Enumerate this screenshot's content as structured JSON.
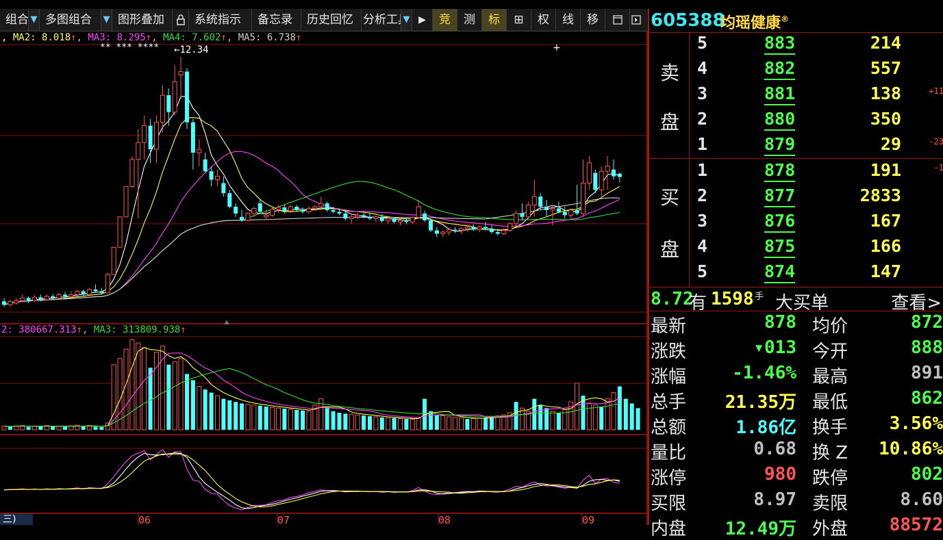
{
  "toolbar": {
    "items": [
      "组合",
      "多图组合",
      "图形叠加",
      "系统指示",
      "备忘录",
      "历史回忆",
      "分析工具"
    ],
    "lock_icon": "lock-icon",
    "play": "▶",
    "icons": [
      "竞",
      "测",
      "标",
      "⊞",
      "权",
      "线",
      "移"
    ],
    "more_icons": [
      "window-icon",
      "next-icon"
    ]
  },
  "legend_main": {
    "ma1": ",",
    "ma2": "MA2: 8.018",
    "ma3": "MA3: 8.295",
    "ma4": "MA4: 7.602",
    "ma5": "MA5: 6.738",
    "peak_label": "12.34",
    "stars": "**  ***  ****"
  },
  "legend_vol": {
    "ma2": "2: 380667.313",
    "ma3": "MA3: 313809.938"
  },
  "x_axis": {
    "left_tab": "三)",
    "months": [
      "06",
      "07",
      "08",
      "09"
    ]
  },
  "colors": {
    "up": "#ff5555",
    "down": "#4dffff",
    "ma1": "#ffffff",
    "ma2": "#ffff4d",
    "ma3": "#ff44ff",
    "ma4": "#33dd33",
    "ma5": "#d0d0d0",
    "grid": "#8a1010"
  },
  "chart_data": {
    "type": "candlestick",
    "candles": [
      {
        "o": 5.1,
        "h": 5.2,
        "l": 4.95,
        "c": 5.0
      },
      {
        "o": 5.0,
        "h": 5.15,
        "l": 4.95,
        "c": 5.1
      },
      {
        "o": 5.05,
        "h": 5.2,
        "l": 5.0,
        "c": 5.12
      },
      {
        "o": 5.12,
        "h": 5.3,
        "l": 5.08,
        "c": 5.2
      },
      {
        "o": 5.2,
        "h": 5.25,
        "l": 5.05,
        "c": 5.12
      },
      {
        "o": 5.12,
        "h": 5.28,
        "l": 5.08,
        "c": 5.22
      },
      {
        "o": 5.22,
        "h": 5.3,
        "l": 5.1,
        "c": 5.15
      },
      {
        "o": 5.15,
        "h": 5.3,
        "l": 5.12,
        "c": 5.25
      },
      {
        "o": 5.25,
        "h": 5.32,
        "l": 5.15,
        "c": 5.2
      },
      {
        "o": 5.2,
        "h": 5.35,
        "l": 5.15,
        "c": 5.3
      },
      {
        "o": 5.3,
        "h": 5.38,
        "l": 5.2,
        "c": 5.25
      },
      {
        "o": 5.25,
        "h": 5.4,
        "l": 5.2,
        "c": 5.3
      },
      {
        "o": 5.3,
        "h": 5.45,
        "l": 5.25,
        "c": 5.4
      },
      {
        "o": 5.4,
        "h": 5.45,
        "l": 5.25,
        "c": 5.3
      },
      {
        "o": 5.3,
        "h": 5.5,
        "l": 5.28,
        "c": 5.45
      },
      {
        "o": 5.45,
        "h": 5.6,
        "l": 5.35,
        "c": 5.4
      },
      {
        "o": 5.4,
        "h": 5.5,
        "l": 5.3,
        "c": 5.35
      },
      {
        "o": 5.35,
        "h": 5.95,
        "l": 5.35,
        "c": 5.9
      },
      {
        "o": 5.9,
        "h": 6.7,
        "l": 5.9,
        "c": 6.7
      },
      {
        "o": 6.7,
        "h": 7.6,
        "l": 6.7,
        "c": 7.6
      },
      {
        "o": 7.6,
        "h": 8.5,
        "l": 7.6,
        "c": 8.5
      },
      {
        "o": 8.5,
        "h": 9.4,
        "l": 8.45,
        "c": 9.3
      },
      {
        "o": 9.3,
        "h": 10.2,
        "l": 7.55,
        "c": 9.8
      },
      {
        "o": 9.8,
        "h": 10.6,
        "l": 9.3,
        "c": 10.3
      },
      {
        "o": 10.3,
        "h": 10.5,
        "l": 9.2,
        "c": 9.6
      },
      {
        "o": 9.6,
        "h": 10.6,
        "l": 9.2,
        "c": 10.4
      },
      {
        "o": 10.4,
        "h": 11.5,
        "l": 10.1,
        "c": 11.2
      },
      {
        "o": 11.2,
        "h": 11.4,
        "l": 10.3,
        "c": 10.7
      },
      {
        "o": 10.7,
        "h": 12.1,
        "l": 10.6,
        "c": 11.6
      },
      {
        "o": 11.8,
        "h": 12.34,
        "l": 11.1,
        "c": 11.9
      },
      {
        "o": 11.9,
        "h": 12.0,
        "l": 10.2,
        "c": 10.4
      },
      {
        "o": 10.4,
        "h": 10.5,
        "l": 9.0,
        "c": 9.5
      },
      {
        "o": 9.5,
        "h": 9.9,
        "l": 9.1,
        "c": 9.6
      },
      {
        "o": 9.3,
        "h": 9.5,
        "l": 8.9,
        "c": 8.95
      },
      {
        "o": 8.95,
        "h": 9.1,
        "l": 8.5,
        "c": 8.7
      },
      {
        "o": 8.7,
        "h": 9.0,
        "l": 8.5,
        "c": 8.8
      },
      {
        "o": 8.6,
        "h": 8.8,
        "l": 8.2,
        "c": 8.3
      },
      {
        "o": 8.3,
        "h": 8.4,
        "l": 7.85,
        "c": 7.9
      },
      {
        "o": 7.9,
        "h": 8.0,
        "l": 7.6,
        "c": 7.7
      },
      {
        "o": 7.6,
        "h": 7.8,
        "l": 7.45,
        "c": 7.5
      },
      {
        "o": 7.5,
        "h": 7.75,
        "l": 7.45,
        "c": 7.7
      },
      {
        "o": 7.7,
        "h": 7.9,
        "l": 7.6,
        "c": 7.85
      },
      {
        "o": 8.0,
        "h": 8.1,
        "l": 7.7,
        "c": 7.75
      },
      {
        "o": 7.6,
        "h": 7.8,
        "l": 7.5,
        "c": 7.65
      },
      {
        "o": 7.65,
        "h": 7.9,
        "l": 7.6,
        "c": 7.82
      },
      {
        "o": 7.82,
        "h": 7.95,
        "l": 7.72,
        "c": 7.88
      },
      {
        "o": 7.88,
        "h": 7.95,
        "l": 7.7,
        "c": 7.78
      },
      {
        "o": 7.78,
        "h": 7.95,
        "l": 7.72,
        "c": 7.9
      },
      {
        "o": 7.9,
        "h": 7.95,
        "l": 7.75,
        "c": 7.8
      },
      {
        "o": 7.8,
        "h": 7.88,
        "l": 7.7,
        "c": 7.75
      },
      {
        "o": 7.75,
        "h": 7.92,
        "l": 7.7,
        "c": 7.85
      },
      {
        "o": 7.85,
        "h": 7.95,
        "l": 7.78,
        "c": 7.9
      },
      {
        "o": 7.9,
        "h": 8.2,
        "l": 7.85,
        "c": 8.0
      },
      {
        "o": 8.0,
        "h": 8.05,
        "l": 7.75,
        "c": 7.8
      },
      {
        "o": 7.8,
        "h": 7.9,
        "l": 7.7,
        "c": 7.75
      },
      {
        "o": 7.75,
        "h": 7.85,
        "l": 7.65,
        "c": 7.7
      },
      {
        "o": 7.7,
        "h": 7.8,
        "l": 7.5,
        "c": 7.55
      },
      {
        "o": 7.55,
        "h": 7.7,
        "l": 7.4,
        "c": 7.6
      },
      {
        "o": 7.6,
        "h": 7.72,
        "l": 7.52,
        "c": 7.65
      },
      {
        "o": 7.65,
        "h": 7.72,
        "l": 7.55,
        "c": 7.6
      },
      {
        "o": 7.6,
        "h": 7.7,
        "l": 7.5,
        "c": 7.55
      },
      {
        "o": 7.55,
        "h": 7.65,
        "l": 7.45,
        "c": 7.6
      },
      {
        "o": 7.6,
        "h": 7.68,
        "l": 7.42,
        "c": 7.48
      },
      {
        "o": 7.48,
        "h": 7.62,
        "l": 7.4,
        "c": 7.55
      },
      {
        "o": 7.55,
        "h": 7.6,
        "l": 7.4,
        "c": 7.45
      },
      {
        "o": 7.45,
        "h": 7.55,
        "l": 7.35,
        "c": 7.5
      },
      {
        "o": 7.5,
        "h": 7.58,
        "l": 7.38,
        "c": 7.45
      },
      {
        "o": 7.45,
        "h": 7.62,
        "l": 7.4,
        "c": 7.58
      },
      {
        "o": 7.58,
        "h": 8.1,
        "l": 7.55,
        "c": 7.9
      },
      {
        "o": 7.7,
        "h": 7.78,
        "l": 7.45,
        "c": 7.5
      },
      {
        "o": 7.5,
        "h": 7.55,
        "l": 7.15,
        "c": 7.2
      },
      {
        "o": 7.2,
        "h": 7.3,
        "l": 7.0,
        "c": 7.1
      },
      {
        "o": 7.1,
        "h": 7.2,
        "l": 7.0,
        "c": 7.15
      },
      {
        "o": 7.15,
        "h": 7.28,
        "l": 7.05,
        "c": 7.22
      },
      {
        "o": 7.22,
        "h": 7.3,
        "l": 7.12,
        "c": 7.2
      },
      {
        "o": 7.2,
        "h": 7.3,
        "l": 7.1,
        "c": 7.25
      },
      {
        "o": 7.25,
        "h": 7.35,
        "l": 7.15,
        "c": 7.3
      },
      {
        "o": 7.3,
        "h": 7.38,
        "l": 7.18,
        "c": 7.22
      },
      {
        "o": 7.22,
        "h": 7.35,
        "l": 7.15,
        "c": 7.3
      },
      {
        "o": 7.3,
        "h": 7.45,
        "l": 7.2,
        "c": 7.25
      },
      {
        "o": 7.25,
        "h": 7.35,
        "l": 7.1,
        "c": 7.15
      },
      {
        "o": 7.15,
        "h": 7.25,
        "l": 7.05,
        "c": 7.1
      },
      {
        "o": 7.1,
        "h": 7.28,
        "l": 7.05,
        "c": 7.2
      },
      {
        "o": 7.2,
        "h": 7.45,
        "l": 7.15,
        "c": 7.4
      },
      {
        "o": 7.4,
        "h": 7.8,
        "l": 7.3,
        "c": 7.7
      },
      {
        "o": 7.7,
        "h": 8.0,
        "l": 7.5,
        "c": 7.6
      },
      {
        "o": 7.6,
        "h": 8.05,
        "l": 7.55,
        "c": 7.95
      },
      {
        "o": 7.95,
        "h": 8.7,
        "l": 7.6,
        "c": 8.2
      },
      {
        "o": 8.2,
        "h": 8.3,
        "l": 7.8,
        "c": 7.9
      },
      {
        "o": 7.9,
        "h": 8.1,
        "l": 7.6,
        "c": 7.8
      },
      {
        "o": 7.8,
        "h": 7.95,
        "l": 7.35,
        "c": 7.85
      },
      {
        "o": 7.85,
        "h": 8.05,
        "l": 7.7,
        "c": 7.75
      },
      {
        "o": 7.75,
        "h": 7.9,
        "l": 7.55,
        "c": 7.65
      },
      {
        "o": 7.65,
        "h": 7.85,
        "l": 7.55,
        "c": 7.8
      },
      {
        "o": 7.8,
        "h": 8.55,
        "l": 7.65,
        "c": 7.7
      },
      {
        "o": 7.7,
        "h": 9.3,
        "l": 7.6,
        "c": 8.6
      },
      {
        "o": 8.6,
        "h": 9.4,
        "l": 8.4,
        "c": 9.2
      },
      {
        "o": 8.9,
        "h": 9.0,
        "l": 8.3,
        "c": 8.4
      },
      {
        "o": 8.4,
        "h": 9.1,
        "l": 8.2,
        "c": 8.95
      },
      {
        "o": 8.95,
        "h": 9.4,
        "l": 8.4,
        "c": 9.1
      },
      {
        "o": 9.0,
        "h": 9.3,
        "l": 8.7,
        "c": 8.8
      },
      {
        "o": 8.88,
        "h": 8.91,
        "l": 8.62,
        "c": 8.78
      }
    ],
    "volume_up": [
      true,
      false,
      true,
      true,
      false,
      true,
      false,
      true,
      false,
      true,
      false,
      true,
      true,
      false,
      true,
      false,
      false,
      true,
      true,
      true,
      true,
      true,
      true,
      true,
      false,
      true,
      true,
      false,
      true,
      true,
      false,
      false,
      true,
      false,
      false,
      true,
      false,
      false,
      false,
      false,
      true,
      true,
      false,
      false,
      true,
      true,
      false,
      true,
      false,
      false,
      true,
      true,
      true,
      false,
      false,
      false,
      false,
      true,
      true,
      false,
      false,
      true,
      false,
      true,
      false,
      true,
      false,
      true,
      true,
      false,
      false,
      false,
      true,
      true,
      true,
      true,
      false,
      true,
      true,
      false,
      false,
      true,
      true,
      true,
      false,
      true,
      true,
      false,
      false,
      false,
      true,
      false,
      true,
      true,
      true,
      false,
      true,
      true,
      false,
      true,
      true,
      false,
      false
    ],
    "volume": [
      12,
      10,
      13,
      14,
      9,
      12,
      11,
      14,
      10,
      12,
      10,
      13,
      15,
      11,
      14,
      10,
      9,
      22,
      210,
      230,
      260,
      290,
      280,
      265,
      200,
      250,
      270,
      210,
      220,
      230,
      180,
      160,
      140,
      130,
      120,
      110,
      100,
      95,
      90,
      85,
      82,
      80,
      78,
      75,
      72,
      70,
      68,
      66,
      64,
      62,
      60,
      80,
      100,
      70,
      60,
      55,
      52,
      50,
      48,
      46,
      44,
      42,
      40,
      38,
      38,
      36,
      35,
      34,
      40,
      100,
      60,
      48,
      45,
      42,
      40,
      38,
      35,
      36,
      38,
      40,
      42,
      45,
      48,
      55,
      90,
      70,
      60,
      100,
      80,
      70,
      60,
      55,
      65,
      90,
      150,
      110,
      85,
      80,
      75,
      100,
      120,
      140,
      100,
      85,
      70
    ],
    "ohlc_fields": [
      "o",
      "h",
      "l",
      "c"
    ]
  },
  "panel": {
    "symbol": "605388",
    "name": "均瑶健康",
    "reg_mark": "®",
    "sell_label": [
      "卖",
      "盘"
    ],
    "buy_label": [
      "买",
      "盘"
    ],
    "sells": [
      {
        "lvl": "5",
        "price": "883",
        "vol": "214",
        "chg": ""
      },
      {
        "lvl": "4",
        "price": "882",
        "vol": "557",
        "chg": ""
      },
      {
        "lvl": "3",
        "price": "881",
        "vol": "138",
        "chg": "+11"
      },
      {
        "lvl": "2",
        "price": "880",
        "vol": "350",
        "chg": ""
      },
      {
        "lvl": "1",
        "price": "879",
        "vol": "29",
        "chg": "-23"
      }
    ],
    "buys": [
      {
        "lvl": "1",
        "price": "878",
        "vol": "191",
        "chg": "-1"
      },
      {
        "lvl": "2",
        "price": "877",
        "vol": "2833",
        "chg": ""
      },
      {
        "lvl": "3",
        "price": "876",
        "vol": "167",
        "chg": ""
      },
      {
        "lvl": "4",
        "price": "875",
        "vol": "166",
        "chg": ""
      },
      {
        "lvl": "5",
        "price": "874",
        "vol": "147",
        "chg": ""
      }
    ],
    "bigbuy": {
      "price": "8.72",
      "have": "有",
      "qty": "1598",
      "unit": "手",
      "label": "大买单",
      "link": "查看>"
    },
    "stats": [
      {
        "k1": "最新",
        "v1": "878",
        "c1": "#4dff4d",
        "k2": "均价",
        "v2": "872",
        "c2": "#4dff4d"
      },
      {
        "k1": "涨跌",
        "v1": "▾013",
        "c1": "#4dff4d",
        "k2": "今开",
        "v2": "888",
        "c2": "#4dff4d"
      },
      {
        "k1": "涨幅",
        "v1": "-1.46%",
        "c1": "#4dff4d",
        "k2": "最高",
        "v2": "891",
        "c2": "#c0c0c0"
      },
      {
        "k1": "总手",
        "v1": "21.35万",
        "c1": "#ffff4d",
        "k2": "最低",
        "v2": "862",
        "c2": "#4dff4d"
      },
      {
        "k1": "总额",
        "v1": "1.86亿",
        "c1": "#4dffff",
        "k2": "换手",
        "v2": "3.56%",
        "c2": "#ffff4d"
      },
      {
        "k1": "量比",
        "v1": "0.68",
        "c1": "#c0c0c0",
        "k2": "换 Z",
        "v2": "10.86%",
        "c2": "#ffff4d"
      },
      {
        "k1": "涨停",
        "v1": "980",
        "c1": "#ff5555",
        "k2": "跌停",
        "v2": "802",
        "c2": "#4dff4d"
      },
      {
        "k1": "买限",
        "v1": "8.97",
        "c1": "#c0c0c0",
        "k2": "卖限",
        "v2": "8.60",
        "c2": "#c0c0c0"
      },
      {
        "k1": "内盘",
        "v1": "12.49万",
        "c1": "#4dff4d",
        "k2": "外盘",
        "v2": "88572",
        "c2": "#ff5555"
      }
    ]
  }
}
